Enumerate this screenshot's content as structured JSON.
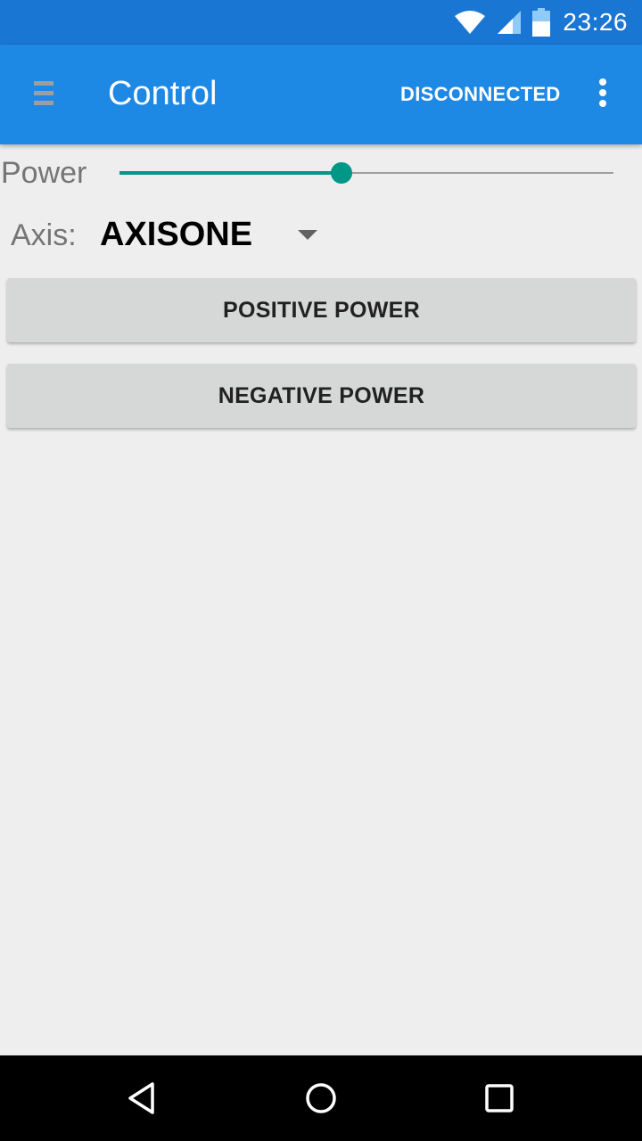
{
  "status_bar": {
    "time": "23:26",
    "icons": [
      "wifi-icon",
      "cell-signal-icon",
      "battery-icon"
    ]
  },
  "app_bar": {
    "title": "Control",
    "connection_status": "DISCONNECTED",
    "icons": [
      "menu-icon",
      "overflow-menu-icon"
    ]
  },
  "power": {
    "label": "Power",
    "slider_fraction": 0.45
  },
  "axis": {
    "label": "Axis:",
    "selected": "AXISONE"
  },
  "buttons": {
    "positive": "POSITIVE POWER",
    "negative": "NEGATIVE POWER"
  },
  "nav_bar": {
    "icons": [
      "back-icon",
      "home-icon",
      "recents-icon"
    ]
  },
  "colors": {
    "status_bar": "#1976d2",
    "app_bar": "#1e88e5",
    "accent": "#009688",
    "background": "#eeeeee",
    "button": "#d6d7d7"
  }
}
